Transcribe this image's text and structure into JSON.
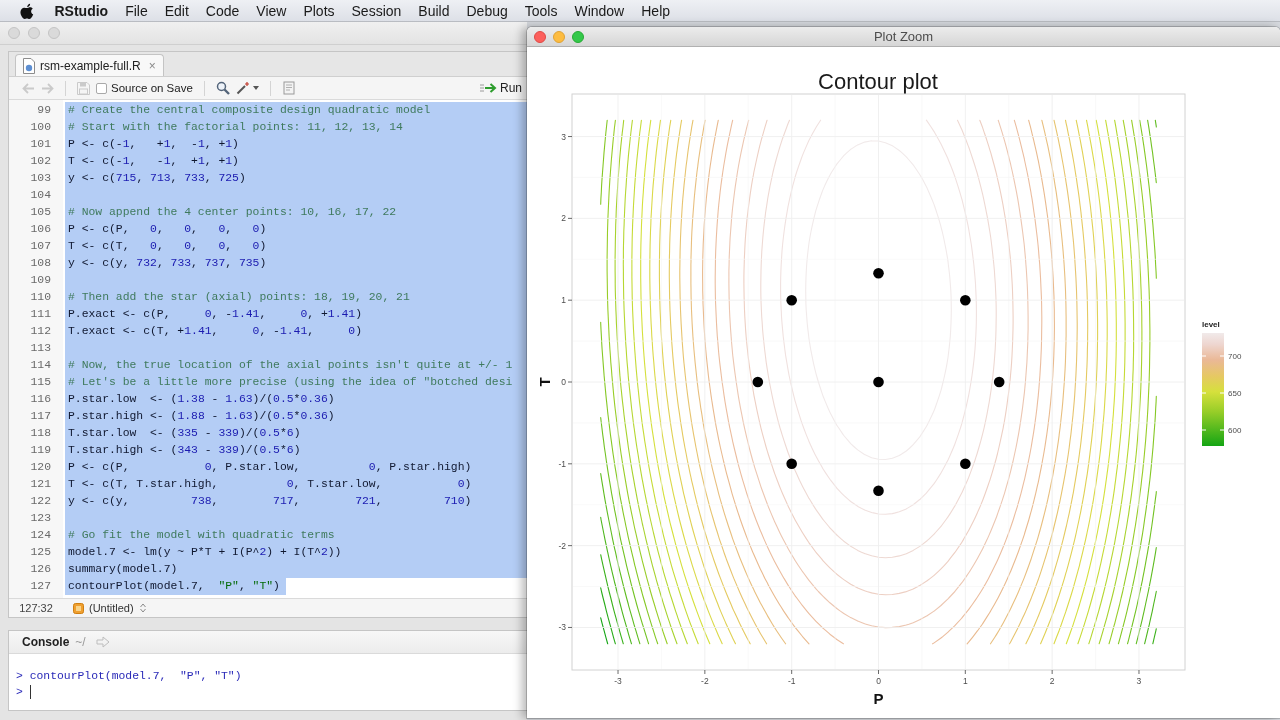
{
  "menu_bar": {
    "app": "RStudio",
    "items": [
      "File",
      "Edit",
      "Code",
      "View",
      "Plots",
      "Session",
      "Build",
      "Debug",
      "Tools",
      "Window",
      "Help"
    ]
  },
  "editor_window": {
    "focused": false,
    "tabs": [
      {
        "label": "rsm-example-full.R",
        "close": "×",
        "selected": true
      }
    ],
    "toolbar": {
      "buttons": [
        {
          "kind": "back",
          "disabled": true
        },
        {
          "kind": "forward",
          "disabled": true
        },
        {
          "kind": "save",
          "disabled": true
        }
      ],
      "source_on_save": {
        "label": "Source on Save",
        "checked": false
      },
      "run": "Run"
    },
    "lines": [
      {
        "number": "99",
        "text": "# Create the central composite design quadratic model",
        "selected": true
      },
      {
        "number": "100",
        "text": "# Start with the factorial points: 11, 12, 13, 14",
        "selected": true
      },
      {
        "number": "101",
        "text": "P <- c(-1,   +1,  -1, +1)",
        "selected": true
      },
      {
        "number": "102",
        "text": "T <- c(-1,   -1,  +1, +1)",
        "selected": true
      },
      {
        "number": "103",
        "text": "y <- c(715, 713, 733, 725)",
        "selected": true
      },
      {
        "number": "104",
        "selected": true
      },
      {
        "number": "105",
        "text": "# Now append the 4 center points: 10, 16, 17, 22",
        "selected": true
      },
      {
        "number": "106",
        "text": "P <- c(P,   0,   0,   0,   0)",
        "selected": true
      },
      {
        "number": "107",
        "text": "T <- c(T,   0,   0,   0,   0)",
        "selected": true
      },
      {
        "number": "108",
        "text": "y <- c(y, 732, 733, 737, 735)",
        "selected": true
      },
      {
        "number": "109",
        "selected": true
      },
      {
        "number": "110",
        "text": "# Then add the star (axial) points: 18, 19, 20, 21",
        "selected": true
      },
      {
        "number": "111",
        "text": "P.exact <- c(P,     0, -1.41,     0, +1.41)",
        "selected": true
      },
      {
        "number": "112",
        "text": "T.exact <- c(T, +1.41,     0, -1.41,     0)",
        "selected": true
      },
      {
        "number": "113",
        "selected": true
      },
      {
        "number": "114",
        "text": "# Now, the true location of the axial points isn't quite at +/- 1",
        "selected": true
      },
      {
        "number": "115",
        "text": "# Let's be a little more precise (using the idea of \"botched desi",
        "selected": true
      },
      {
        "number": "116",
        "text": "P.star.low  <- (1.38 - 1.63)/(0.5*0.36)",
        "selected": true
      },
      {
        "number": "117",
        "text": "P.star.high <- (1.88 - 1.63)/(0.5*0.36)",
        "selected": true
      },
      {
        "number": "118",
        "text": "T.star.low  <- (335 - 339)/(0.5*6)",
        "selected": true
      },
      {
        "number": "119",
        "text": "T.star.high <- (343 - 339)/(0.5*6)",
        "selected": true
      },
      {
        "number": "120",
        "text": "P <- c(P,           0, P.star.low,          0, P.star.high)",
        "selected": true
      },
      {
        "number": "121",
        "text": "T <- c(T, T.star.high,          0, T.star.low,           0)",
        "selected": true
      },
      {
        "number": "122",
        "text": "y <- c(y,         738,        717,        721,         710)",
        "selected": true
      },
      {
        "number": "123",
        "selected": true
      },
      {
        "number": "124",
        "text": "# Go fit the model with quadratic terms",
        "selected": true
      },
      {
        "number": "125",
        "text": "model.7 <- lm(y ~ P*T + I(P^2) + I(T^2))",
        "selected": true
      },
      {
        "number": "126",
        "text": "summary(model.7)",
        "selected": true
      },
      {
        "number": "127",
        "text": "contourPlot(model.7,  \"P\", \"T\")",
        "selected": true
      }
    ],
    "status_bar": {
      "position": "127:32",
      "scope": "(Untitled)"
    },
    "console": {
      "title": "Console",
      "path": "~/",
      "history": [
        {
          "prompt": ">",
          "command": "contourPlot(model.7,  \"P\", \"T\")"
        }
      ],
      "input": {
        "prompt": ">"
      }
    }
  },
  "plot_window": {
    "title": "Plot Zoom",
    "focused": true,
    "chart_data": {
      "type": "scatter",
      "title": "Contour plot",
      "xlabel": "P",
      "ylabel": "T",
      "x": [
        0,
        -1,
        1,
        -1.39,
        0,
        1.39,
        -1,
        1,
        0
      ],
      "values": [
        1.33,
        1,
        1,
        0,
        0,
        0,
        -1,
        -1,
        -1.33
      ],
      "xlim": [
        -3.53,
        3.53
      ],
      "ylim": [
        -3.52,
        3.52
      ],
      "xticks": [
        -3,
        -2,
        -1,
        0,
        1,
        2,
        3
      ],
      "yticks": [
        -3,
        -2,
        -1,
        0,
        1,
        2,
        3
      ],
      "grid": true
    },
    "legend": {
      "title": "level",
      "labels": [
        "700",
        "650",
        "600"
      ]
    }
  }
}
